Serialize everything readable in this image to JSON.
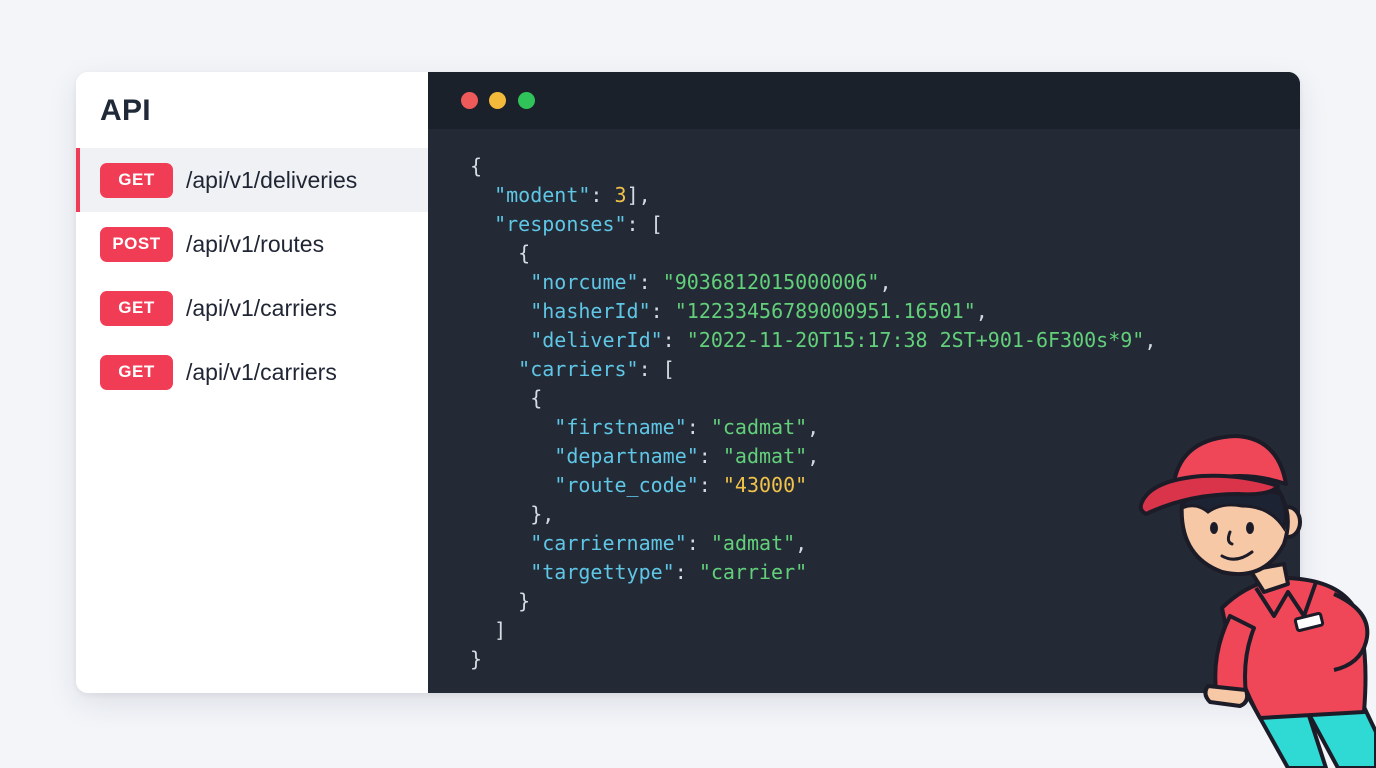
{
  "sidebar": {
    "title": "API",
    "endpoints": [
      {
        "method": "GET",
        "path": "/api/v1/deliveries",
        "active": true
      },
      {
        "method": "POST",
        "path": "/api/v1/routes",
        "active": false
      },
      {
        "method": "GET",
        "path": "/api/v1/carriers",
        "active": false
      },
      {
        "method": "GET",
        "path": "/api/v1/carriers",
        "active": false
      }
    ]
  },
  "window_controls": [
    "close",
    "minimize",
    "maximize"
  ],
  "code": {
    "lines": [
      [
        [
          "p",
          "{"
        ]
      ],
      [
        [
          "p",
          "  "
        ],
        [
          "k",
          "\"modent\""
        ],
        [
          "p",
          ": "
        ],
        [
          "n",
          "3"
        ],
        [
          "p",
          "],"
        ]
      ],
      [
        [
          "p",
          "  "
        ],
        [
          "k",
          "\"responses\""
        ],
        [
          "p",
          ": ["
        ]
      ],
      [
        [
          "p",
          "    {"
        ]
      ],
      [
        [
          "p",
          "     "
        ],
        [
          "k",
          "\"norcume\""
        ],
        [
          "p",
          ": "
        ],
        [
          "s",
          "\"9036812015000006\""
        ],
        [
          "p",
          ","
        ]
      ],
      [
        [
          "p",
          "     "
        ],
        [
          "k",
          "\"hasherId\""
        ],
        [
          "p",
          ": "
        ],
        [
          "s",
          "\"12233456789000951.16501\""
        ],
        [
          "p",
          ","
        ]
      ],
      [
        [
          "p",
          "     "
        ],
        [
          "k",
          "\"deliverId\""
        ],
        [
          "p",
          ": "
        ],
        [
          "s",
          "\"2022-11-20T15:17:38 2ST+901-6F300s*9\""
        ],
        [
          "p",
          ","
        ]
      ],
      [
        [
          "p",
          "    "
        ],
        [
          "k",
          "\"carriers\""
        ],
        [
          "p",
          ": ["
        ]
      ],
      [
        [
          "p",
          "     {"
        ]
      ],
      [
        [
          "p",
          "       "
        ],
        [
          "k",
          "\"firstname\""
        ],
        [
          "p",
          ": "
        ],
        [
          "s",
          "\"cadmat\""
        ],
        [
          "p",
          ","
        ]
      ],
      [
        [
          "p",
          "       "
        ],
        [
          "k",
          "\"departname\""
        ],
        [
          "p",
          ": "
        ],
        [
          "s",
          "\"admat\""
        ],
        [
          "p",
          ","
        ]
      ],
      [
        [
          "p",
          "       "
        ],
        [
          "k",
          "\"route_code\""
        ],
        [
          "p",
          ": "
        ],
        [
          "n",
          "\"43000\""
        ]
      ],
      [
        [
          "p",
          "     },"
        ]
      ],
      [
        [
          "p",
          "     "
        ],
        [
          "k",
          "\"carriername\""
        ],
        [
          "p",
          ": "
        ],
        [
          "s",
          "\"admat\""
        ],
        [
          "p",
          ","
        ]
      ],
      [
        [
          "p",
          "     "
        ],
        [
          "k",
          "\"targettype\""
        ],
        [
          "p",
          ": "
        ],
        [
          "s",
          "\"carrier\""
        ]
      ],
      [
        [
          "p",
          "    }"
        ]
      ],
      [
        [
          "p",
          "  ]"
        ]
      ],
      [
        [
          "p",
          "}"
        ]
      ]
    ]
  },
  "colors": {
    "method_badge": "#f03c55",
    "active_indicator": "#ef3b55",
    "editor_bg": "#232a35",
    "json_key": "#5fc6e6",
    "json_string": "#62d07a",
    "json_number": "#f1c24a"
  },
  "mascot": "delivery-person-illustration"
}
